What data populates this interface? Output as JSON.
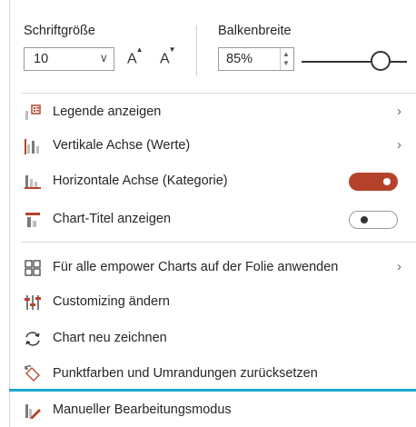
{
  "top": {
    "font_size_label": "Schriftgröße",
    "font_size_value": "10",
    "grow_font_label": "A",
    "shrink_font_label": "A",
    "bar_width_label": "Balkenbreite",
    "bar_width_value": "85%",
    "bar_width_slider": 0.73
  },
  "menu": {
    "legend": "Legende anzeigen",
    "vertical_axis": "Vertikale Achse (Werte)",
    "horizontal_axis": "Horizontale Achse (Kategorie)",
    "chart_title": "Chart-Titel anzeigen",
    "apply_all": "Für alle empower Charts auf der Folie anwenden",
    "customizing": "Customizing ändern",
    "redraw": "Chart neu zeichnen",
    "reset_colors": "Punktfarben und Umrandungen zurücksetzen",
    "manual_mode": "Manueller Bearbeitungsmodus"
  },
  "toggles": {
    "horizontal_axis_on": true,
    "chart_title_on": false
  },
  "colors": {
    "toggle_on": "#b5432b",
    "highlight": "#1aa7cf"
  },
  "icons": {
    "legend": "legend-icon",
    "vertical_axis": "vertical-axis-icon",
    "horizontal_axis": "horizontal-axis-icon",
    "chart_title": "chart-title-icon",
    "apply_all": "grid-apply-icon",
    "customizing": "customizing-icon",
    "redraw": "redraw-icon",
    "reset_colors": "reset-colors-icon",
    "manual_mode": "manual-edit-icon"
  }
}
